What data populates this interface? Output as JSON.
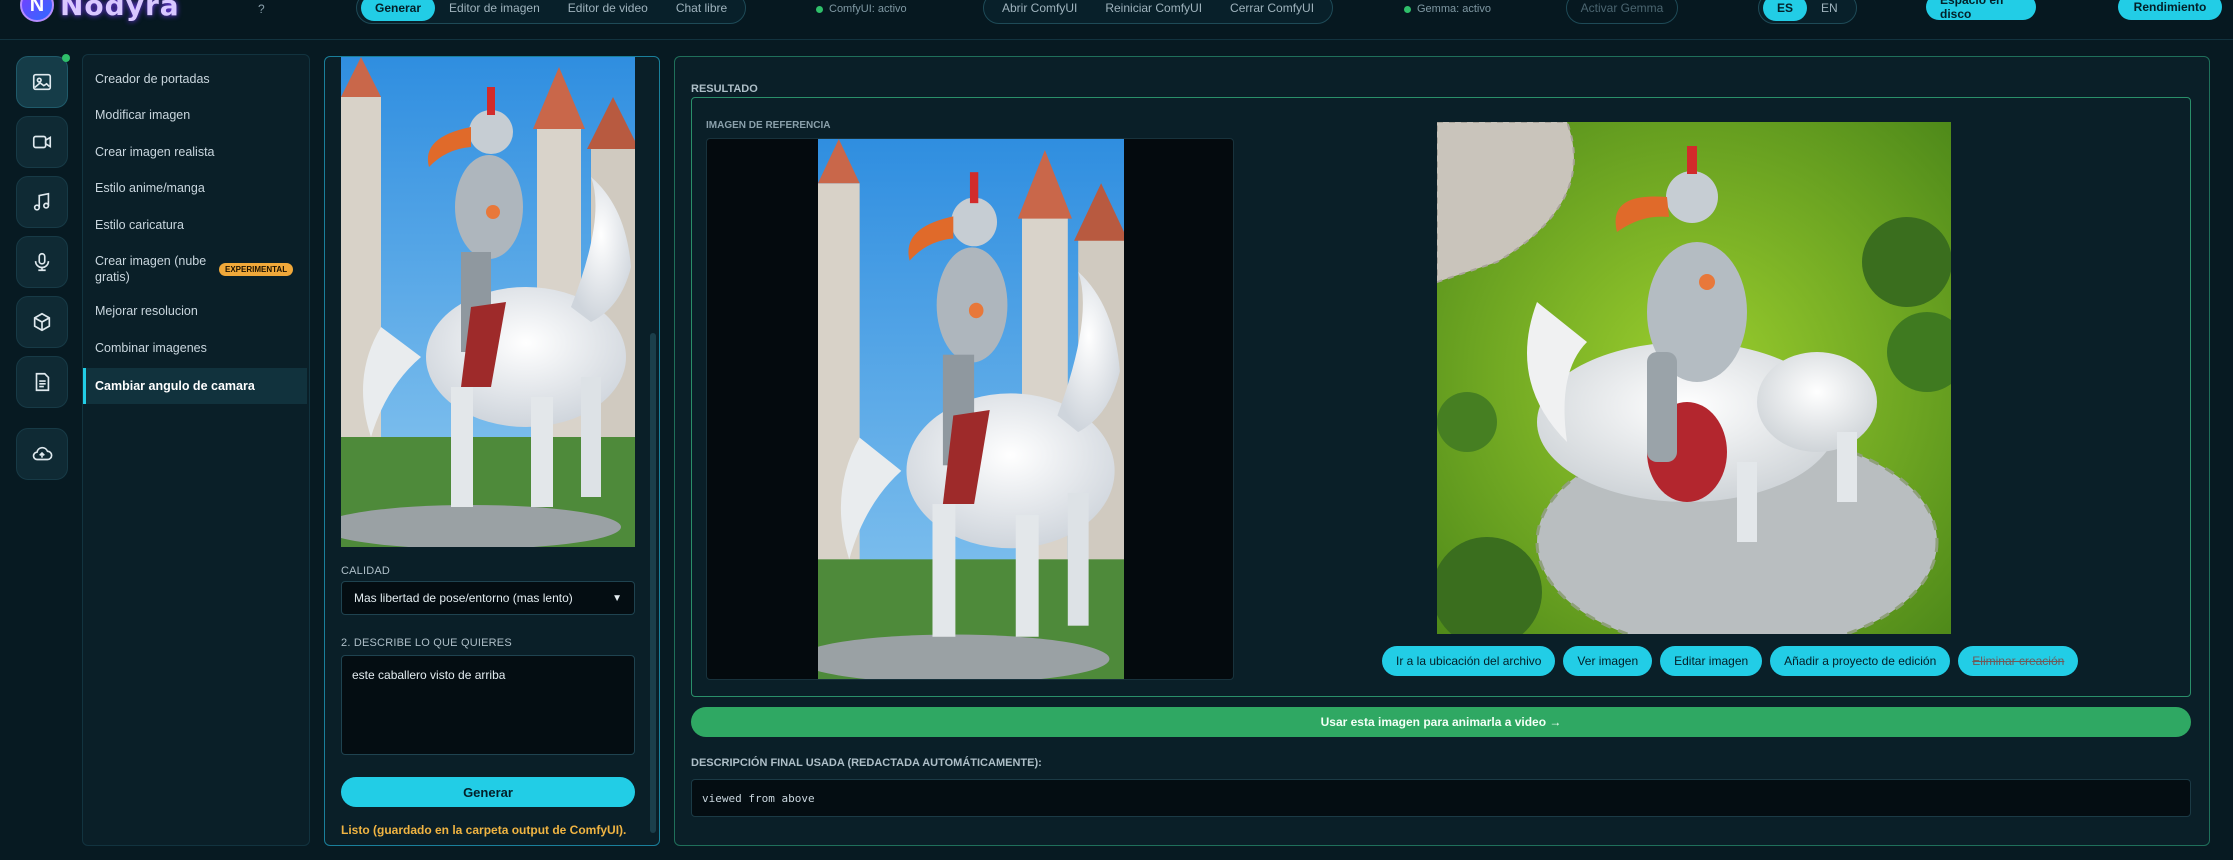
{
  "app": {
    "logo_text": "Nodyra",
    "help": "?"
  },
  "topbar": {
    "tabs": [
      "Generar",
      "Editor de imagen",
      "Editor de video",
      "Chat libre"
    ],
    "comfy_status": "ComfyUI: activo",
    "comfy_actions": [
      "Abrir ComfyUI",
      "Reiniciar ComfyUI",
      "Cerrar ComfyUI"
    ],
    "gemma_status": "Gemma: activo",
    "activate_gemma": "Activar Gemma",
    "languages": [
      "ES",
      "EN"
    ],
    "disk_space": "Espacio en disco",
    "performance": "Rendimiento"
  },
  "rail": {
    "icons": [
      "image-icon",
      "video-icon",
      "music-icon",
      "microphone-icon",
      "cube-icon",
      "document-icon",
      "cloud-upload-icon"
    ]
  },
  "menu": {
    "items": [
      "Creador de portadas",
      "Modificar imagen",
      "Crear imagen realista",
      "Estilo anime/manga",
      "Estilo caricatura",
      "Crear imagen (nube gratis)",
      "Mejorar resolucion",
      "Combinar imagenes",
      "Cambiar angulo de camara"
    ],
    "experimental_badge": "EXPERIMENTAL",
    "active_index": 8
  },
  "form": {
    "quality_label": "CALIDAD",
    "quality_value": "Mas libertad de pose/entorno (mas lento)",
    "describe_label": "2. DESCRIBE LO QUE QUIERES",
    "describe_value": "este caballero visto de arriba",
    "generate": "Generar",
    "status": "Listo (guardado en la carpeta output de ComfyUI)."
  },
  "result": {
    "title": "RESULTADO",
    "reference_label": "IMAGEN DE REFERENCIA",
    "actions": [
      "Ir a la ubicación del archivo",
      "Ver imagen",
      "Editar imagen",
      "Añadir a proyecto de edición",
      "Eliminar creación"
    ],
    "animate": "Usar esta imagen para animarla a video →",
    "final_label": "DESCRIPCIÓN FINAL USADA (REDACTADA AUTOMÁTICAMENTE):",
    "final_value": "viewed from above"
  },
  "colors": {
    "accent": "#22cde6",
    "success": "#2fa863",
    "warning": "#f0b442",
    "background": "#071a22"
  }
}
